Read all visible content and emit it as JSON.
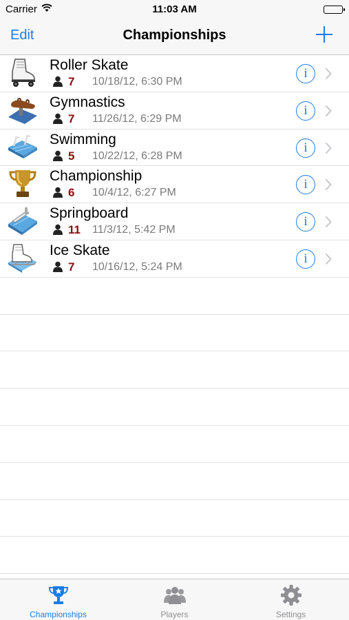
{
  "status_bar": {
    "carrier": "Carrier",
    "time": "11:03 AM",
    "wifi_icon": "wifi-icon",
    "battery_icon": "battery-icon",
    "battery_level": 1.0
  },
  "nav": {
    "edit_label": "Edit",
    "title": "Championships",
    "add_icon": "plus-icon"
  },
  "championships": [
    {
      "name": "Roller Skate",
      "players": "7",
      "date": "10/18/12, 6:30 PM",
      "icon": "roller-skate-icon"
    },
    {
      "name": "Gymnastics",
      "players": "7",
      "date": "11/26/12, 6:29 PM",
      "icon": "pommel-horse-icon"
    },
    {
      "name": "Swimming",
      "players": "5",
      "date": "10/22/12, 6:28 PM",
      "icon": "swimming-pool-icon"
    },
    {
      "name": "Championship",
      "players": "6",
      "date": "10/4/12, 6:27 PM",
      "icon": "trophy-icon"
    },
    {
      "name": "Springboard",
      "players": "11",
      "date": "11/3/12, 5:42 PM",
      "icon": "springboard-icon"
    },
    {
      "name": "Ice Skate",
      "players": "7",
      "date": "10/16/12, 5:24 PM",
      "icon": "ice-skate-icon"
    }
  ],
  "tab_bar": {
    "tabs": [
      {
        "label": "Championships",
        "icon": "trophy-star-icon",
        "active": true
      },
      {
        "label": "Players",
        "icon": "players-icon",
        "active": false
      },
      {
        "label": "Settings",
        "icon": "gear-icon",
        "active": false
      }
    ]
  },
  "colors": {
    "accent": "#1a7ce8",
    "player_count": "#8a0f0f",
    "secondary_text": "#7a7a7a"
  }
}
